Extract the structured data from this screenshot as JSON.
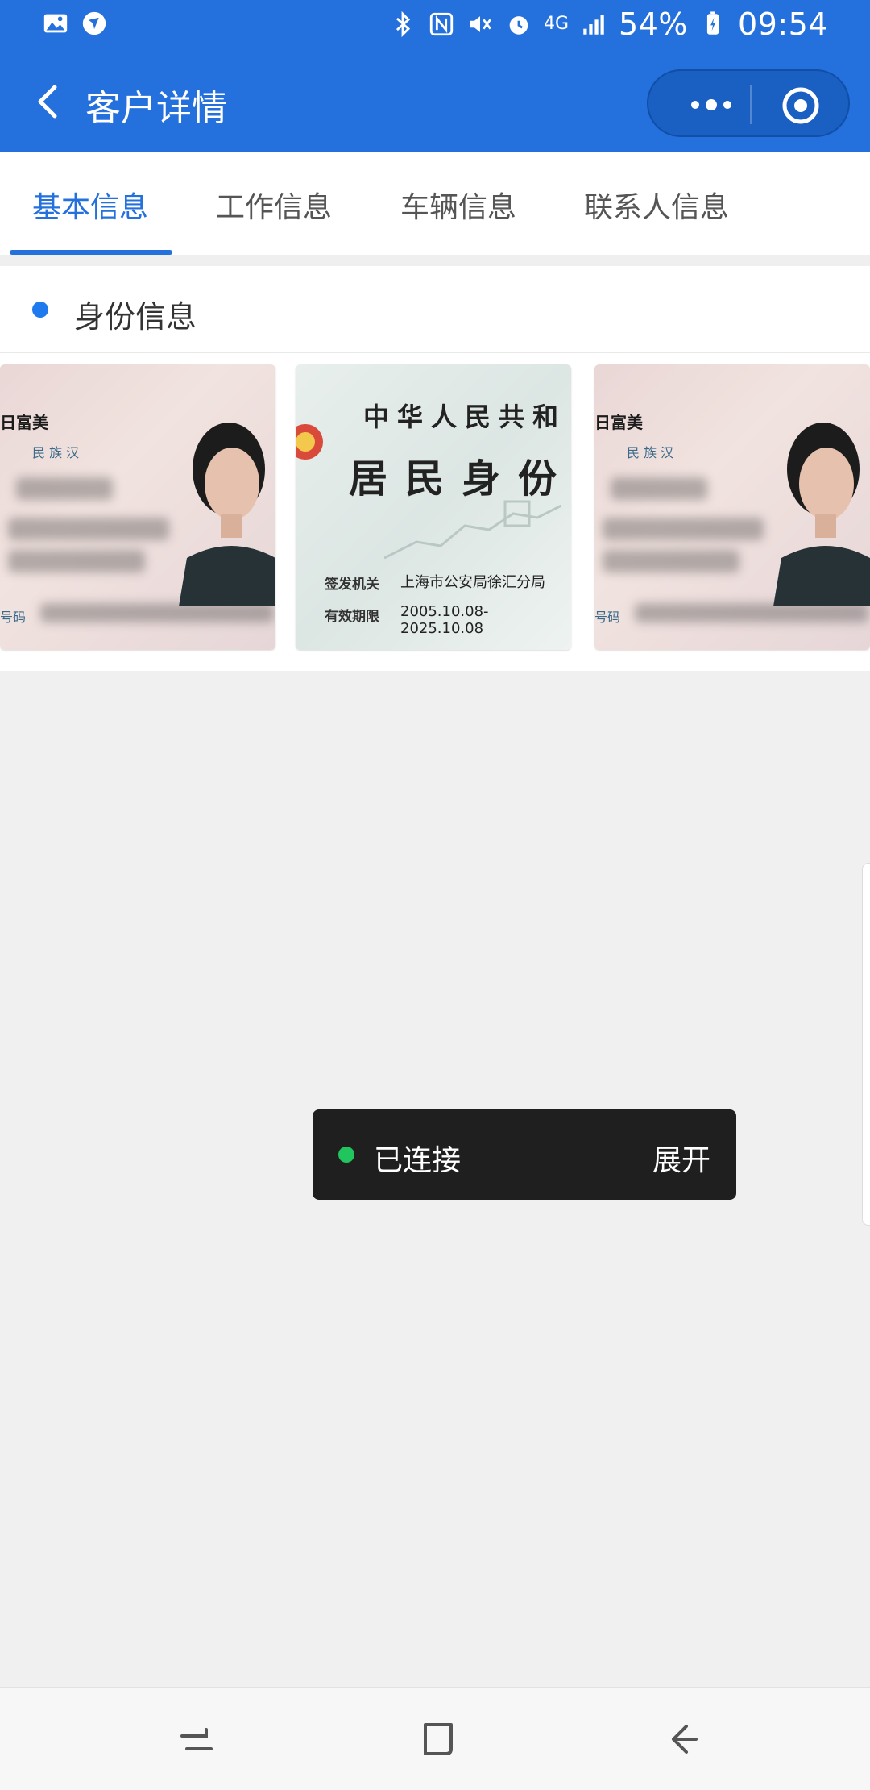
{
  "status_bar": {
    "battery": "54%",
    "time": "09:54",
    "network": "4G",
    "icons": [
      "gallery-icon",
      "vpn-icon",
      "bluetooth-icon",
      "nfc-icon",
      "mute-icon",
      "alarm-icon",
      "signal-icon",
      "battery-icon"
    ]
  },
  "header": {
    "title": "客户详情",
    "colors": {
      "bar": "#2470dc"
    }
  },
  "tabs": [
    {
      "label": "基本信息",
      "active": true
    },
    {
      "label": "工作信息",
      "active": false
    },
    {
      "label": "车辆信息",
      "active": false
    },
    {
      "label": "联系人信息",
      "active": false
    }
  ],
  "section": {
    "title": "身份信息"
  },
  "id_front": {
    "name_partial": "日富美",
    "ethnicity": "民 族 汉",
    "number_label": "号码"
  },
  "id_back": {
    "title_line1": "中华人民共和",
    "title_line2": "居民身份",
    "authority_label": "签发机关",
    "authority_value": "上海市公安局徐汇分局",
    "validity_label": "有效期限",
    "validity_value": "2005.10.08-2025.10.08"
  },
  "toast": {
    "status": "已连接",
    "action": "展开",
    "status_color": "#21c55d"
  }
}
